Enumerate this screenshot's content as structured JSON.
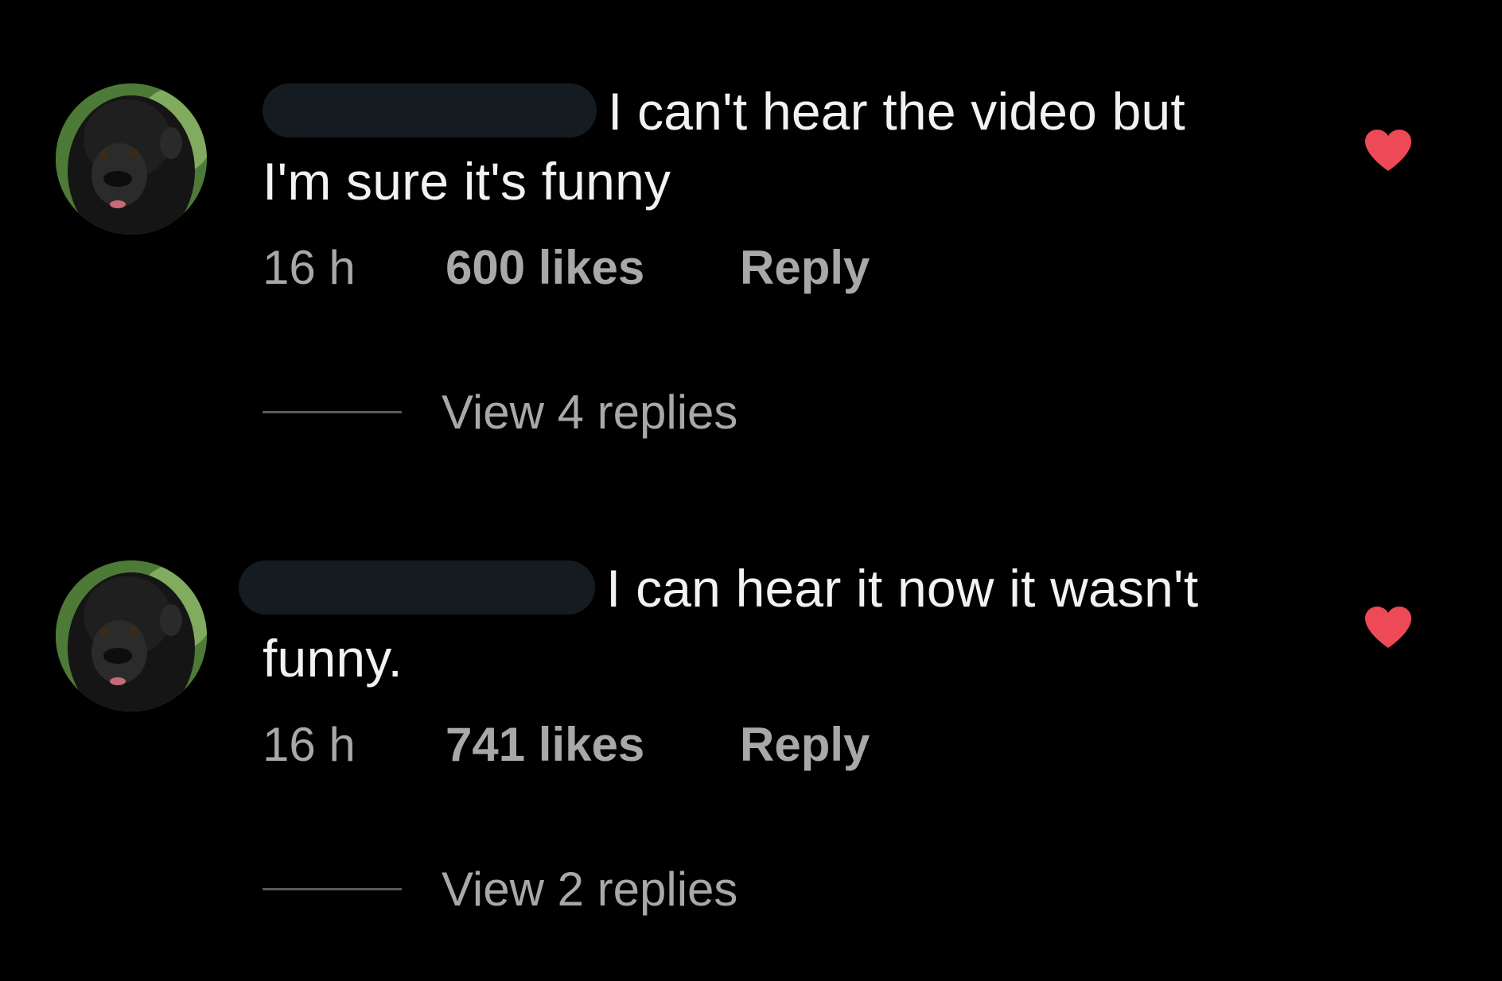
{
  "colors": {
    "background": "#000000",
    "text_primary": "#f2f2f2",
    "text_secondary": "#a8a8a8",
    "like_heart": "#ed4956",
    "redaction": "#141b21"
  },
  "comments": [
    {
      "avatar_icon": "gorilla-avatar",
      "username_redacted": true,
      "text_line_1": "I can't hear the video but",
      "text_line_2": "I'm sure it's funny",
      "time": "16 h",
      "likes": "600 likes",
      "reply_label": "Reply",
      "view_replies": "View 4 replies",
      "liked": true
    },
    {
      "avatar_icon": "gorilla-avatar",
      "username_redacted": true,
      "text_line_1": "I can hear it now it wasn't",
      "text_line_2": "funny.",
      "time": "16 h",
      "likes": "741 likes",
      "reply_label": "Reply",
      "view_replies": "View 2 replies",
      "liked": true
    }
  ]
}
